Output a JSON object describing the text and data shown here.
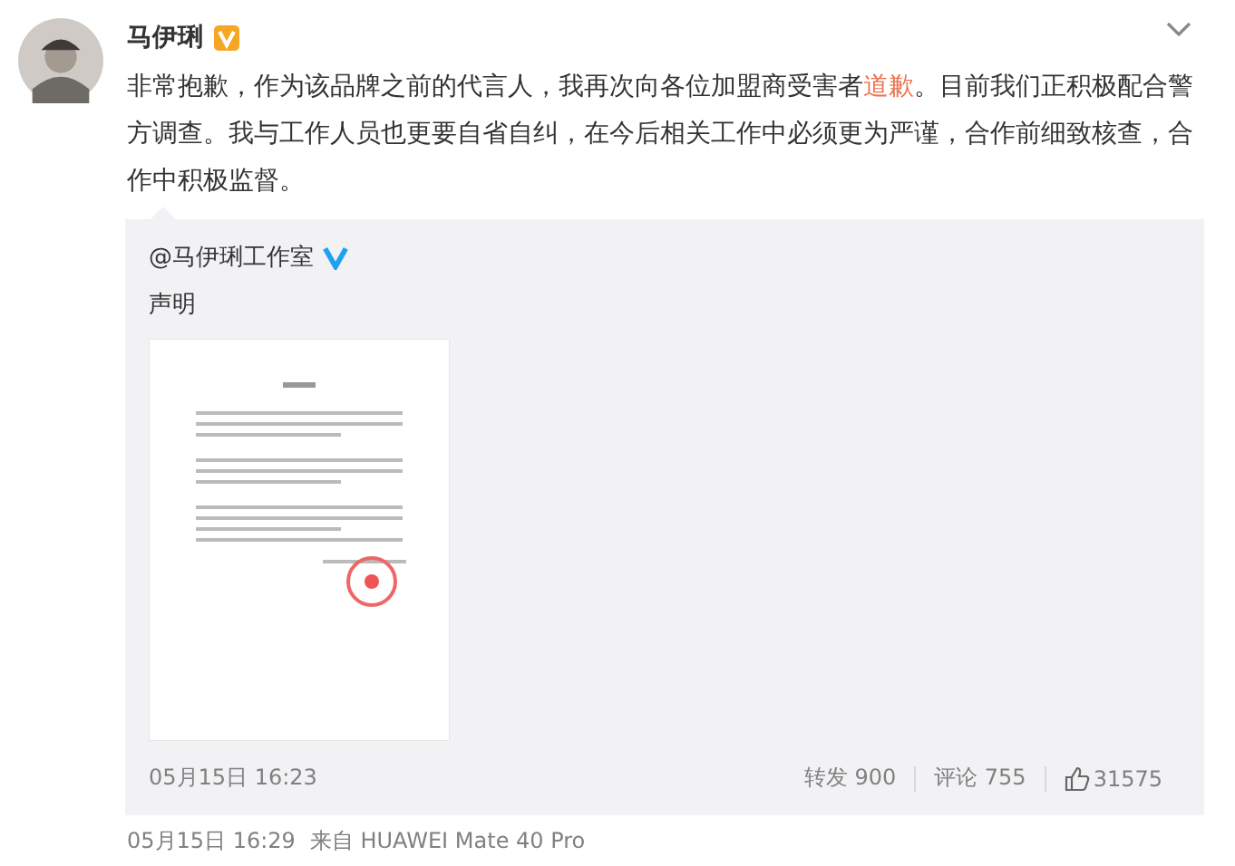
{
  "post": {
    "author": "马伊琍",
    "verified": true,
    "text": "非常抱歉，作为该品牌之前的代言人，我再次向各位加盟商受害者**道歉**。目前我们正积极配合警方调查。我与工作人员也更要自省自纠，在今后相关工作中必须更为严谨，合作前细致核查，合作中积极监督。",
    "repost": {
      "author": "@马伊琍工作室",
      "verified": true,
      "text": "声明",
      "time": "05月15日 16:23",
      "stats": [
        {
          "kind": "repost",
          "label": "转发 900"
        },
        {
          "kind": "comment",
          "label": "评论 755"
        },
        {
          "kind": "like",
          "label": "31575"
        }
      ]
    },
    "time": "05月15日 16:29",
    "source": "来自 HUAWEI Mate 40 Pro"
  }
}
